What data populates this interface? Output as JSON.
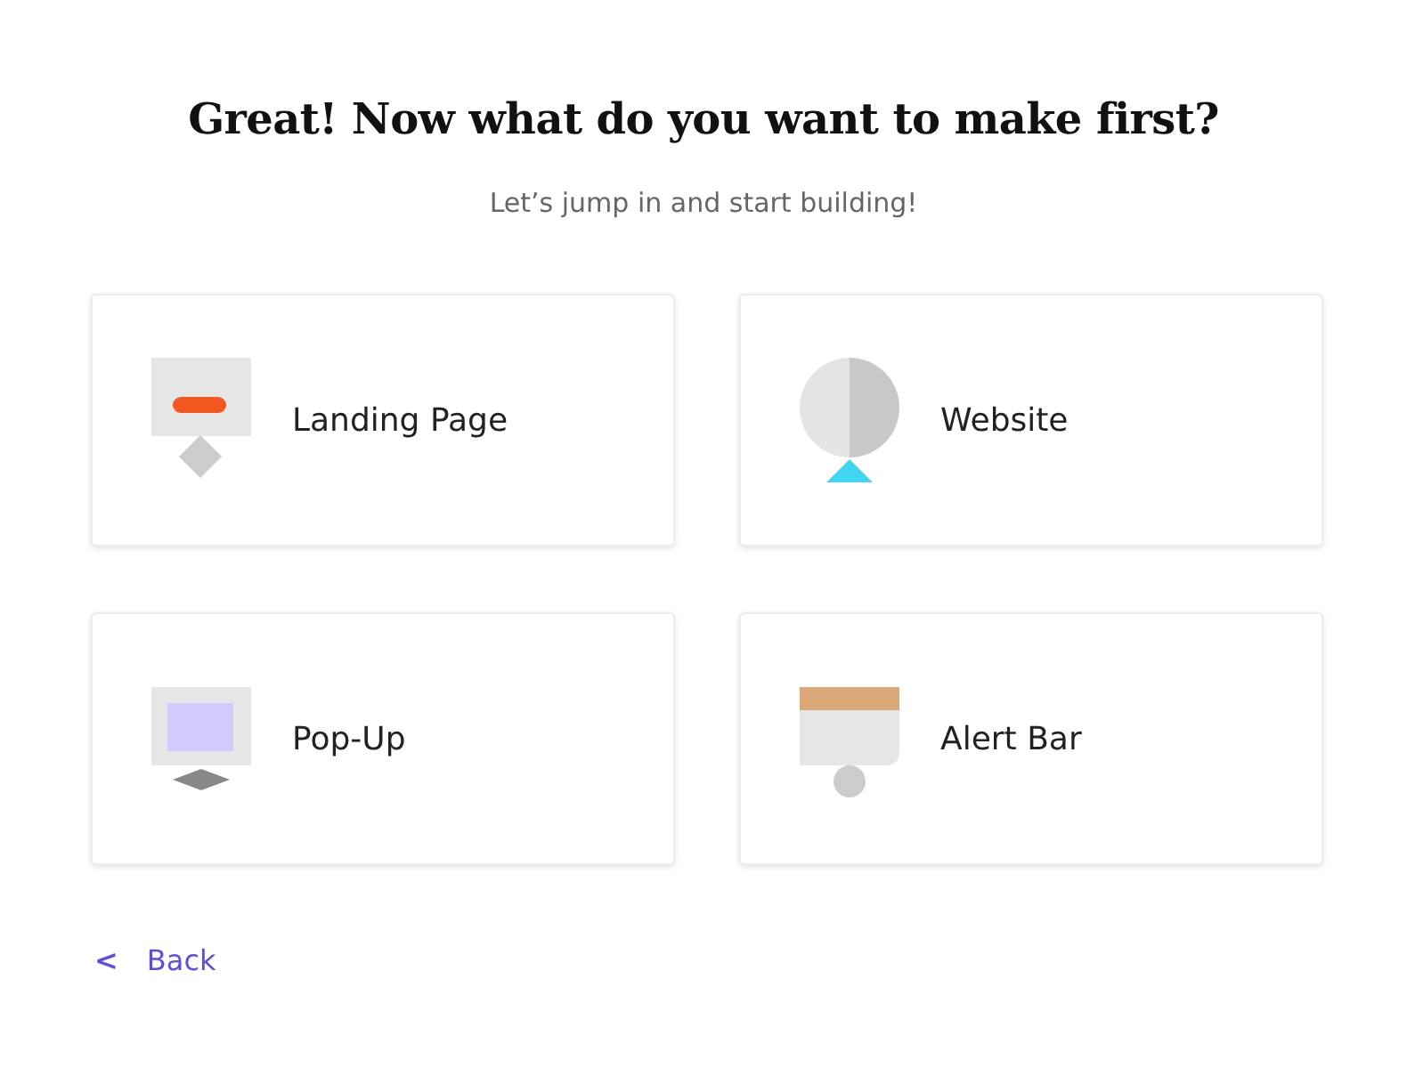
{
  "title": "Great! Now what do you want to make first?",
  "subtitle": "Let’s jump in and start building!",
  "options": [
    {
      "kind": "landing",
      "label": "Landing Page"
    },
    {
      "kind": "website",
      "label": "Website"
    },
    {
      "kind": "popup",
      "label": "Pop-Up"
    },
    {
      "kind": "alert",
      "label": "Alert Bar"
    }
  ],
  "back": {
    "icon": "<",
    "label": "Back"
  }
}
